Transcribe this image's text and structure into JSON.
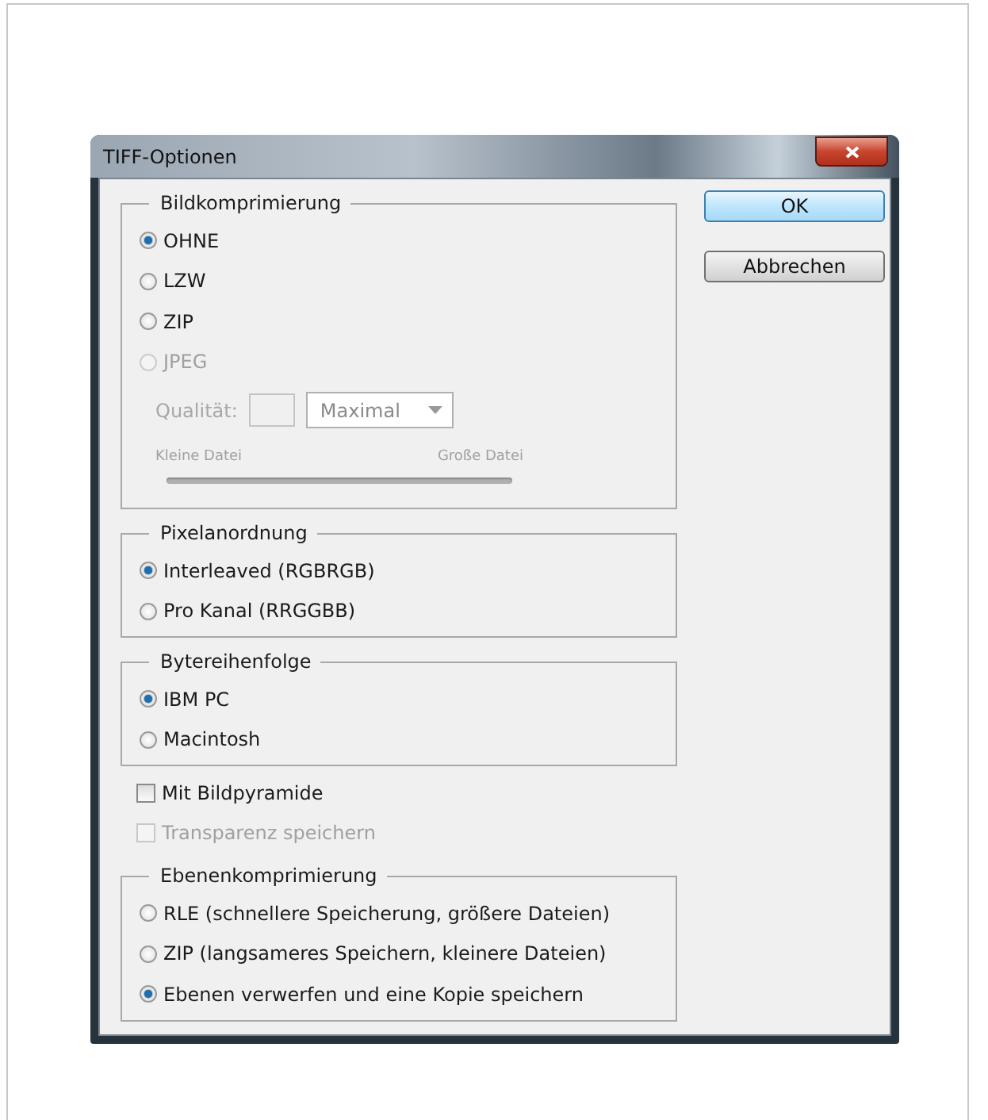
{
  "window": {
    "title": "TIFF-Optionen"
  },
  "sections": [
    {
      "kind": "radio_group",
      "title": "Bildkomprimierung",
      "options": [
        {
          "label": "OHNE",
          "selected": true,
          "disabled": false
        },
        {
          "label": "LZW",
          "selected": false,
          "disabled": false
        },
        {
          "label": "ZIP",
          "selected": false,
          "disabled": false
        },
        {
          "label": "JPEG",
          "selected": false,
          "disabled": true
        }
      ],
      "quality": {
        "label": "Qualität:",
        "disabled": true,
        "dropdown": "Maximal",
        "min_label": "Kleine Datei",
        "max_label": "Große Datei"
      }
    },
    {
      "kind": "radio_group",
      "title": "Pixelanordnung",
      "options": [
        {
          "label": "Interleaved (RGBRGB)",
          "selected": true,
          "disabled": false
        },
        {
          "label": "Pro Kanal (RRGGBB)",
          "selected": false,
          "disabled": false
        }
      ]
    },
    {
      "kind": "radio_group",
      "title": "Bytereihenfolge",
      "options": [
        {
          "label": "IBM PC",
          "selected": true,
          "disabled": false
        },
        {
          "label": "Macintosh",
          "selected": false,
          "disabled": false
        }
      ]
    },
    {
      "kind": "checkbox",
      "label": "Mit Bildpyramide",
      "checked": false,
      "disabled": false
    },
    {
      "kind": "checkbox",
      "label": "Transparenz speichern",
      "checked": false,
      "disabled": true
    },
    {
      "kind": "radio_group",
      "title": "Ebenenkomprimierung",
      "options": [
        {
          "label": "RLE (schnellere Speicherung, größere Dateien)",
          "selected": false,
          "disabled": false
        },
        {
          "label": "ZIP (langsameres Speichern, kleinere Dateien)",
          "selected": false,
          "disabled": false
        },
        {
          "label": "Ebenen verwerfen und eine Kopie speichern",
          "selected": true,
          "disabled": false
        }
      ]
    }
  ],
  "buttons": [
    {
      "label": "OK",
      "default": true
    },
    {
      "label": "Abbrechen",
      "default": false
    }
  ]
}
